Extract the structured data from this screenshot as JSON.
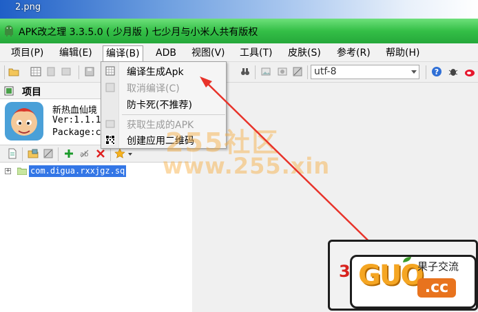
{
  "window": {
    "background_label": "2.png",
    "title": "APK改之理 3.3.5.0 ( 少月版 )  七少月与小米人共有版权"
  },
  "menubar": {
    "items": [
      {
        "label": "项目(P)"
      },
      {
        "label": "编辑(E)"
      },
      {
        "label": "编译(B)"
      },
      {
        "label": "ADB"
      },
      {
        "label": "视图(V)"
      },
      {
        "label": "工具(T)"
      },
      {
        "label": "皮肤(S)"
      },
      {
        "label": "参考(R)"
      },
      {
        "label": "帮助(H)"
      }
    ]
  },
  "toolbar": {
    "encoding_value": "utf-8"
  },
  "dropdown": {
    "items": [
      {
        "label": "编译生成Apk",
        "enabled": true,
        "icon": "build-apk-icon"
      },
      {
        "label": "取消编译(C)",
        "enabled": false,
        "icon": "cancel-build-icon"
      },
      {
        "label": "防卡死(不推荐)",
        "enabled": true,
        "icon": ""
      },
      {
        "label": "获取生成的APK",
        "enabled": false,
        "icon": "get-apk-icon"
      },
      {
        "label": "创建应用二维码",
        "enabled": true,
        "icon": "qr-code-icon"
      }
    ]
  },
  "project_panel": {
    "header": "项目",
    "app_name": "新热血仙境",
    "version": "Ver:1.1.1",
    "package": "Package:c",
    "tree_items": [
      {
        "label": "com.digua.rxxjgz.sq",
        "selected": true
      }
    ]
  },
  "watermark": {
    "text_top": "255社区",
    "text_bottom": "www.255.xin"
  },
  "stamp": {
    "number": "3",
    "brand": "GUO",
    "domain": ".cc",
    "slogan": "果子交流"
  },
  "colors": {
    "titlebar_green": "#34bf47",
    "selection_blue": "#3376e6",
    "arrow_red": "#e8332a",
    "watermark_orange": "#f6aa3c"
  }
}
